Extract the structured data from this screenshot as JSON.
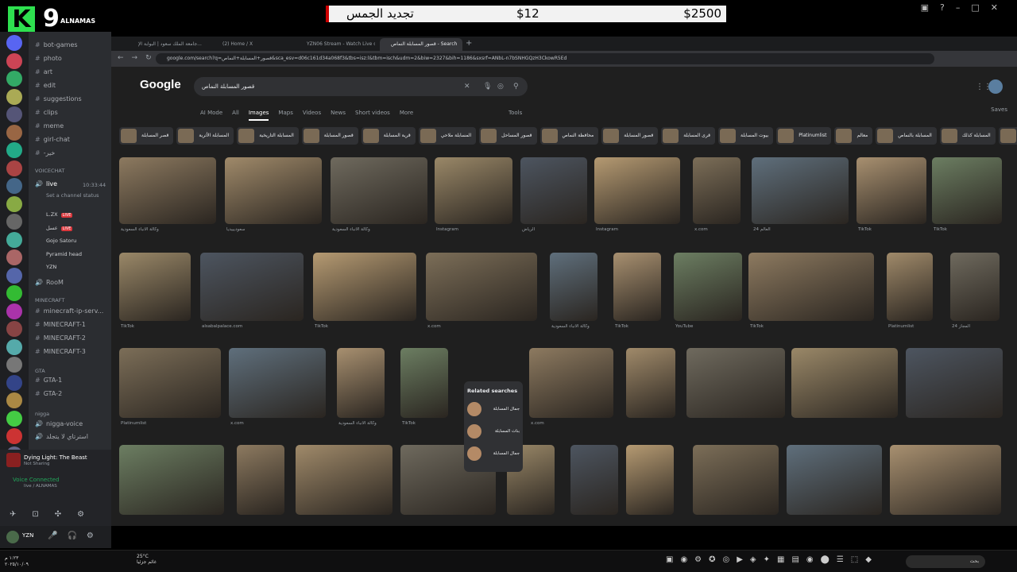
{
  "overlay": {
    "logo_letter": "K",
    "logo_number": "9",
    "server_name": "ALNAMAS",
    "ticker": {
      "label": "تجديد الجمس",
      "price": "$12",
      "total": "$2500"
    }
  },
  "discord": {
    "channels": [
      "bot-games",
      "photo",
      "art",
      "edit",
      "suggestions",
      "clips",
      "meme",
      "girl-chat",
      "-خير"
    ],
    "voicechat_category": "VOICECHAT",
    "live_channel": "live",
    "live_time": "10:33:44",
    "status_hint": "Set a channel status",
    "voice_users": [
      "L.ZX",
      "عسل",
      "Gojo Satoru",
      "Pyramid head",
      "YZN"
    ],
    "live_badge": "LIVE",
    "room": "RooM",
    "minecraft_category": "MINECRAFT",
    "minecraft_channels": [
      "minecraft-ip-serv...",
      "MINECRAFT-1",
      "MINECRAFT-2",
      "MINECRAFT-3"
    ],
    "gta_category": "GTA",
    "gta_channels": [
      "GTA-1",
      "GTA-2"
    ],
    "nigga_category": "nigga",
    "nigga_channels": [
      "nigga-voice",
      "استرتاي لا يتجلد"
    ],
    "game": "Dying Light: The Beast",
    "game_status": "Not Sharing",
    "voice_connected": "Voice Connected",
    "voice_channel": "live / ALNAMAS",
    "user": "YZN",
    "new_badge": "NEW"
  },
  "browser": {
    "tabs": [
      "جامعة الملك سعود | البوابة الإ...",
      "(2) Home / X",
      "YZN06 Stream - Watch Live on ...",
      "قصور المسابلة النماص - Search"
    ],
    "url": "google.com/search?q=قصور+المسابلة+النماص&sca_esv=d06c161d34a068f3&tbs=isz:l&tbm=isch&udm=2&biw=2327&bih=1186&sxsrf=ANbL-n7bSNHGQzH3CkowR5Ed",
    "google": {
      "logo": "Google",
      "query": "قصور المسابلة النماص",
      "tabs": [
        "AI Mode",
        "All",
        "Images",
        "Maps",
        "Videos",
        "News",
        "Short videos",
        "More"
      ],
      "tools": "Tools",
      "saves": "Saves",
      "chips": [
        "قصر المسابلة",
        "المسابلة الأثرية",
        "المسابلة التاريخية",
        "قصور المسابلة",
        "قرية المسابلة",
        "المسابلة ملاحي",
        "قصور المساحل",
        "محافظة النماص",
        "قصور المسابلة",
        "قرى المسابلة",
        "بيوت المسابلة",
        "Platinumlist",
        "معالم",
        "المسابلة بالنماص",
        "المسابلة كذلك",
        "تراثية"
      ],
      "related": {
        "title": "Related searches",
        "items": [
          "جمال المسابلة",
          "بنات المسابلة",
          "جمال المسابلة"
        ]
      },
      "captions": [
        "وكالة الأنباء السعودية",
        "سعوديبيديا",
        "وكالة الأنباء السعودية",
        "Instagram",
        "الرياض",
        "Instagram",
        "x.com",
        "24 العالم",
        "TikTok",
        "TikTok",
        "TikTok",
        "alsabalpalace.com",
        "TikTok",
        "x.com",
        "وكالة الأنباء السعودية",
        "TikTok",
        "YouTube",
        "TikTok",
        "Platinumlist",
        "24 المجاز",
        "Platinumlist",
        "x.com",
        "وكالة الأنباء السعودية",
        "TikTok",
        "x.com"
      ]
    }
  },
  "taskbar": {
    "weather_temp": "25°C",
    "weather_desc": "غائم جزئيا",
    "time": "١:٢٣ م",
    "date": "٢٠٢٥/١٠/٠٩",
    "search": "بحث"
  }
}
